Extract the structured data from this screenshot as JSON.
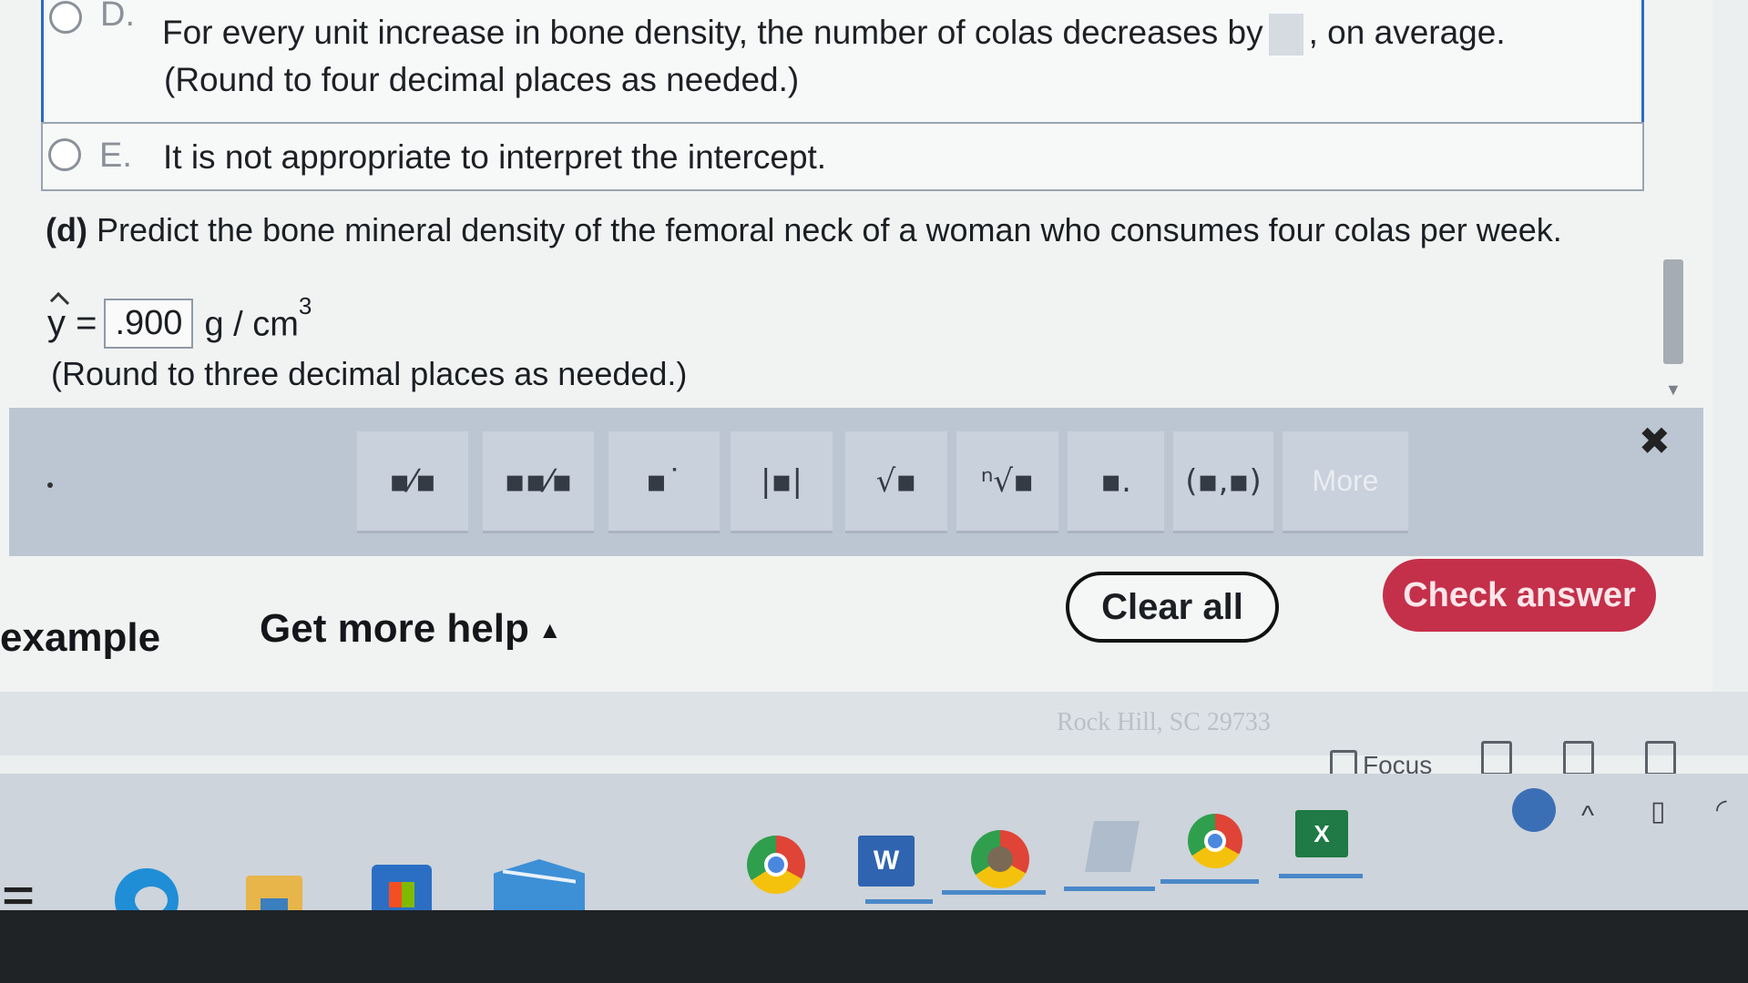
{
  "option_d": {
    "letter": "D.",
    "text_before": "For every unit increase in bone density, the number of colas decreases by",
    "text_after": ", on average.",
    "note": "(Round to four decimal places as needed.)"
  },
  "option_e": {
    "letter": "E.",
    "text": "It is not appropriate to interpret the intercept."
  },
  "part_d": {
    "label": "(d)",
    "question": "Predict the bone mineral density of the femoral neck of a woman who consumes four colas per week.",
    "yhat_label": "y =",
    "answer_value": ".900",
    "unit": "g / cm",
    "unit_exp": "3",
    "note": "(Round to three decimal places as needed.)"
  },
  "palette": {
    "buttons": [
      "fraction-icon",
      "mixed-number-icon",
      "exponent-icon",
      "absolute-value-icon",
      "sqrt-icon",
      "nth-root-icon",
      "decimal-icon",
      "ordered-pair-icon"
    ],
    "glyphs": [
      "▪⁄▪",
      "▪▪⁄▪",
      "▪˙",
      "|▪|",
      "√▪",
      "ⁿ√▪",
      "▪.",
      "(▪,▪)"
    ],
    "more_label": "More",
    "close_glyph": "✖"
  },
  "bottom": {
    "example_label": "example",
    "help_label": "Get more help",
    "help_caret": "▲",
    "clear_label": "Clear all",
    "check_label": "Check answer",
    "accent_color": "#c4304a"
  },
  "footer": {
    "location_text": "Rock Hill, SC 29733"
  },
  "browser": {
    "focus_label": "Focus"
  },
  "taskbar": {
    "apps": [
      "edge-icon",
      "file-explorer-icon",
      "store-icon",
      "mail-icon",
      "chrome-icon",
      "word-icon",
      "chrome-profile-icon",
      "folder-icon",
      "chrome-icon-2",
      "excel-icon"
    ],
    "word_letter": "W",
    "excel_letter": "X"
  }
}
